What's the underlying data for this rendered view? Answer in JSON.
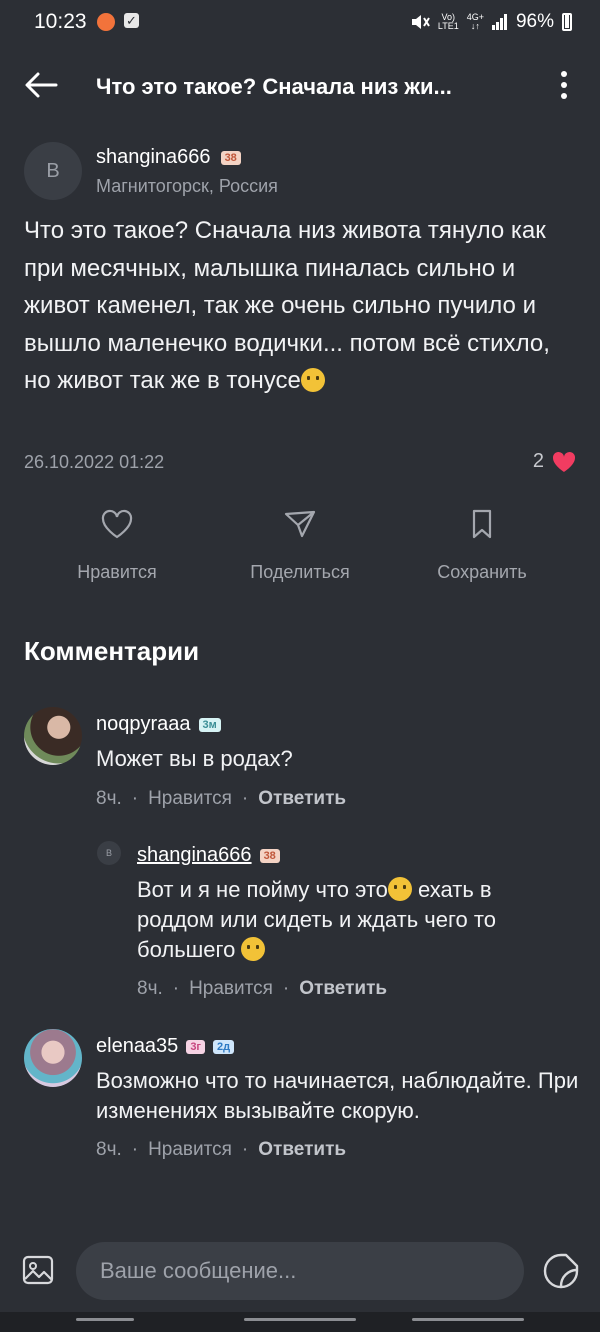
{
  "status_bar": {
    "time": "10:23",
    "network_top": "Vo)",
    "network_bottom": "LTE1",
    "signal_top": "4G+",
    "battery": "96%"
  },
  "header": {
    "title": "Что это такое? Сначала низ жи..."
  },
  "post": {
    "author_initial": "В",
    "author": "shangina666",
    "author_badge": "38",
    "location": "Магнитогорск, Россия",
    "text": "Что это такое? Сначала низ живота тянуло как при месячных, малышка пиналась сильно и живот каменел, так же очень сильно пучило и вышло маленечко водички... потом всё стихло, но живот так же в тонусе",
    "date": "26.10.2022 01:22",
    "likes": "2"
  },
  "actions": {
    "like": "Нравится",
    "share": "Поделиться",
    "save": "Сохранить"
  },
  "comments_title": "Комментарии",
  "comments": [
    {
      "author": "noqpyraaa",
      "badges": [
        "3м"
      ],
      "text": "Может вы в родах?",
      "time": "8ч.",
      "like": "Нравится",
      "reply": "Ответить"
    },
    {
      "author_initial": "В",
      "author": "shangina666",
      "badges": [
        "38"
      ],
      "text_a": "Вот и я не пойму что это",
      "text_b": " ехать в роддом или сидеть и ждать чего то большего ",
      "time": "8ч.",
      "like": "Нравится",
      "reply": "Ответить"
    },
    {
      "author": "elenaa35",
      "badges": [
        "3г",
        "2д"
      ],
      "text": "Возможно что то начинается, наблюдайте. При изменениях вызывайте скорую.",
      "time": "8ч.",
      "like": "Нравится",
      "reply": "Ответить"
    }
  ],
  "composer": {
    "placeholder": "Ваше сообщение..."
  },
  "colors": {
    "background": "#2c2f35",
    "heart": "#f23c61"
  }
}
